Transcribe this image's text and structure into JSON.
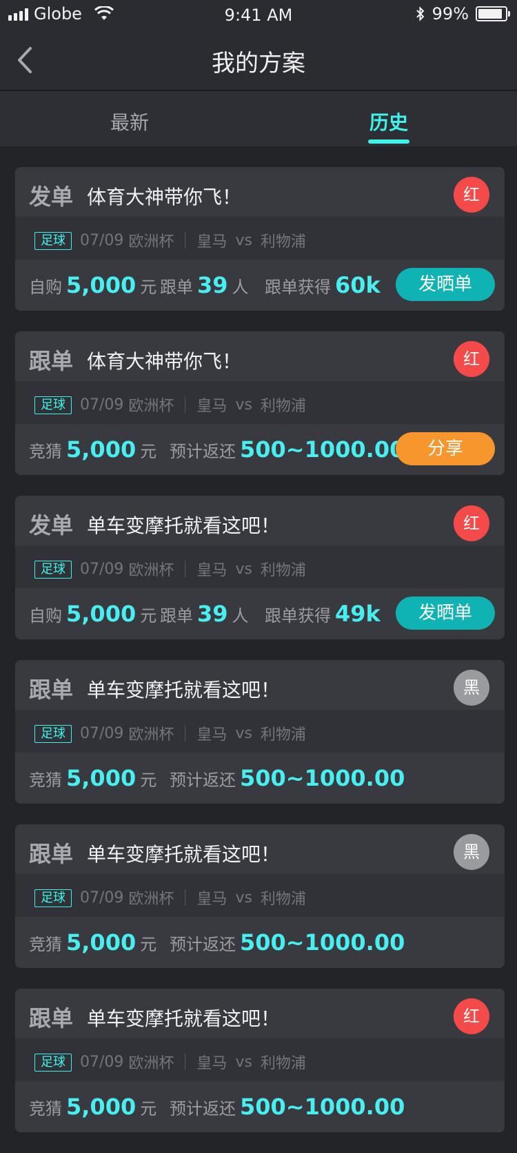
{
  "status_bar": {
    "carrier": "Globe",
    "time": "9:41 AM",
    "battery": "99%",
    "battery_level": 0.99
  },
  "nav": {
    "title": "我的方案"
  },
  "tabs": [
    {
      "label": "最新"
    },
    {
      "label": "历史"
    }
  ],
  "cards": [
    {
      "type": "发单",
      "title": "体育大神带你飞！",
      "badge": "红",
      "tag": "足球",
      "date": "07/09",
      "league": "欧洲杯",
      "home": "皇马",
      "vs": "vs",
      "away": "利物浦",
      "s1_label": "自购",
      "s1_value": "5,000",
      "s1_unit": "元",
      "s2_label": "跟单",
      "s2_value": "39",
      "s2_unit": "人",
      "s3_label": "跟单获得",
      "s3_value": "60k",
      "button": "发晒单"
    },
    {
      "type": "跟单",
      "title": "体育大神带你飞！",
      "badge": "红",
      "tag": "足球",
      "date": "07/09",
      "league": "欧洲杯",
      "home": "皇马",
      "vs": "vs",
      "away": "利物浦",
      "s1_label": "竞猜",
      "s1_value": "5,000",
      "s1_unit": "元",
      "s2_label": "预计返还",
      "s2_value": "500~1000.00",
      "button": "分享"
    },
    {
      "type": "发单",
      "title": "单车变摩托就看这吧！",
      "badge": "红",
      "tag": "足球",
      "date": "07/09",
      "league": "欧洲杯",
      "home": "皇马",
      "vs": "vs",
      "away": "利物浦",
      "s1_label": "自购",
      "s1_value": "5,000",
      "s1_unit": "元",
      "s2_label": "跟单",
      "s2_value": "39",
      "s2_unit": "人",
      "s3_label": "跟单获得",
      "s3_value": "49k",
      "button": "发晒单"
    },
    {
      "type": "跟单",
      "title": "单车变摩托就看这吧！",
      "badge": "黑",
      "tag": "足球",
      "date": "07/09",
      "league": "欧洲杯",
      "home": "皇马",
      "vs": "vs",
      "away": "利物浦",
      "s1_label": "竞猜",
      "s1_value": "5,000",
      "s1_unit": "元",
      "s2_label": "预计返还",
      "s2_value": "500~1000.00"
    },
    {
      "type": "跟单",
      "title": "单车变摩托就看这吧！",
      "badge": "黑",
      "tag": "足球",
      "date": "07/09",
      "league": "欧洲杯",
      "home": "皇马",
      "vs": "vs",
      "away": "利物浦",
      "s1_label": "竞猜",
      "s1_value": "5,000",
      "s1_unit": "元",
      "s2_label": "预计返还",
      "s2_value": "500~1000.00"
    },
    {
      "type": "跟单",
      "title": "单车变摩托就看这吧！",
      "badge": "红",
      "tag": "足球",
      "date": "07/09",
      "league": "欧洲杯",
      "home": "皇马",
      "vs": "vs",
      "away": "利物浦",
      "s1_label": "竞猜",
      "s1_value": "5,000",
      "s1_unit": "元",
      "s2_label": "预计返还",
      "s2_value": "500~1000.00"
    }
  ],
  "colors": {
    "accent": "#3ff3ec",
    "red_badge": "#f54a4a",
    "black_badge": "#9a9b9f",
    "teal_button": "#10b3b3",
    "orange_button": "#f7962c"
  }
}
